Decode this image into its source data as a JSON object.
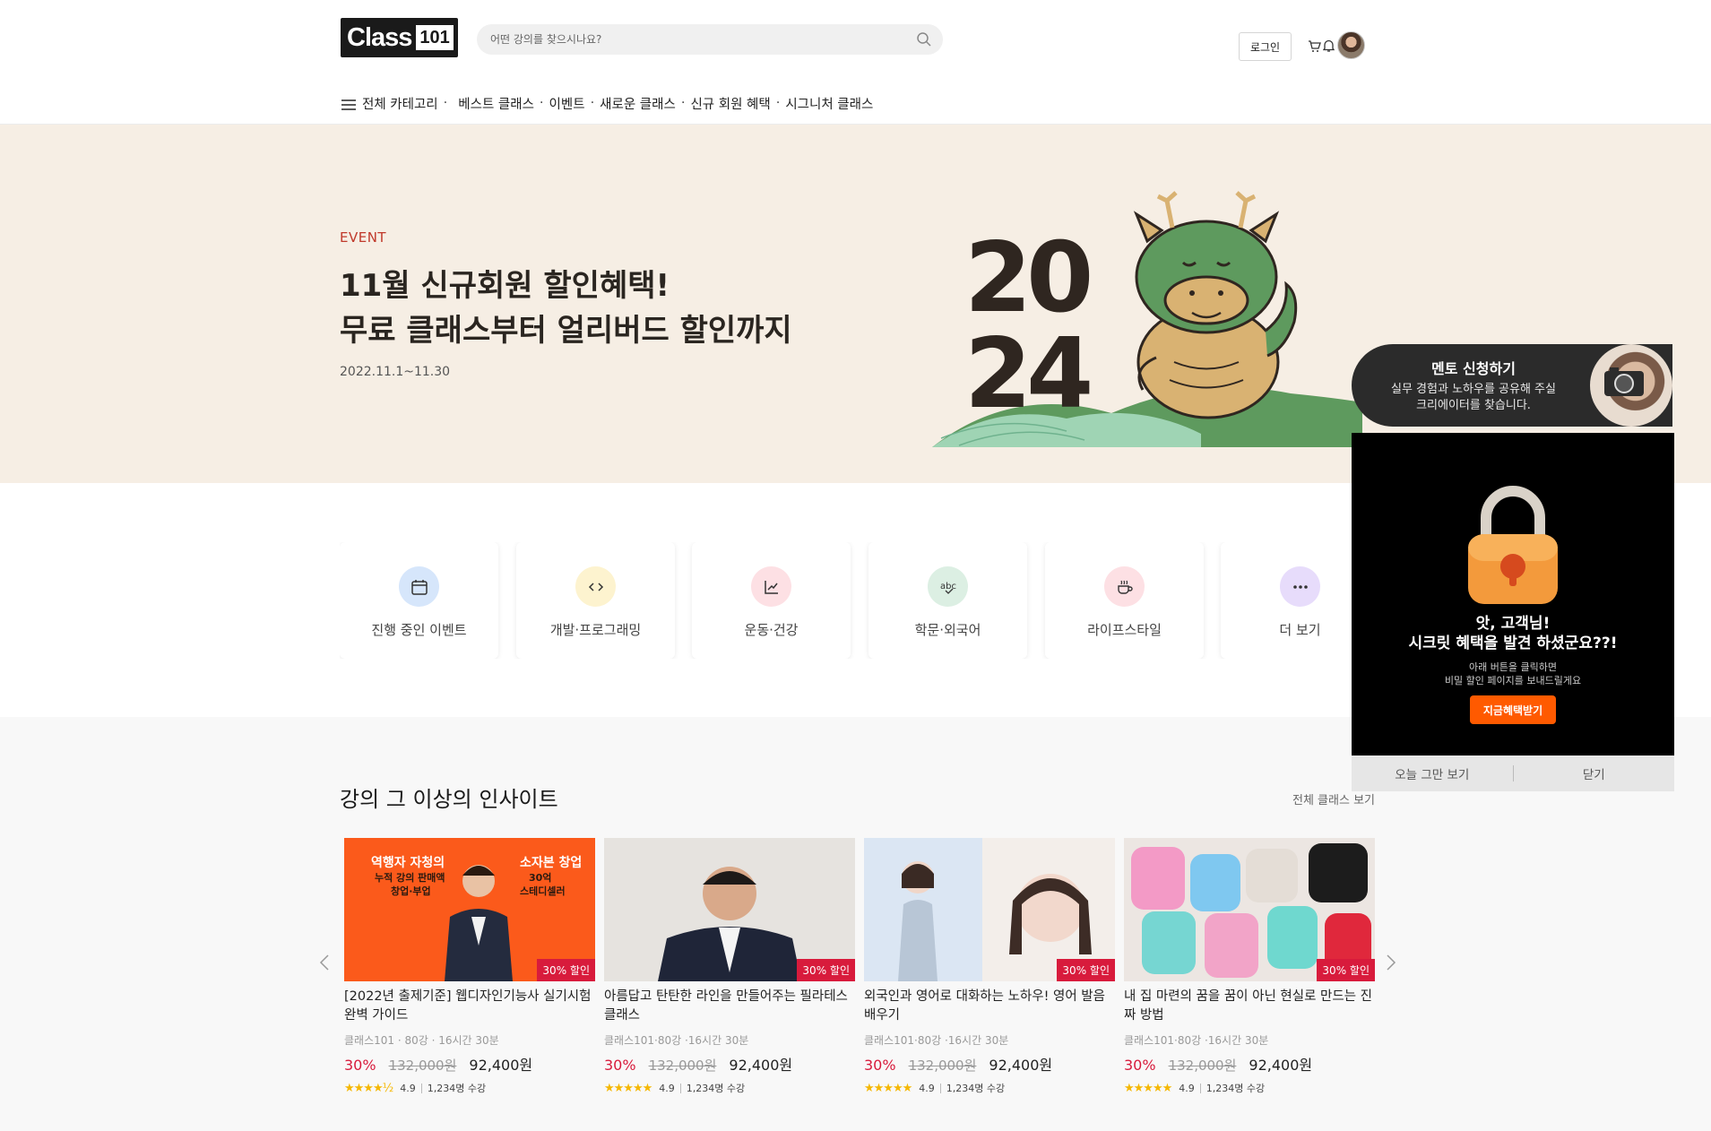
{
  "header": {
    "logo_text": "Class",
    "logo_number": "101",
    "search_placeholder": "어떤 강의를 찾으시나요?",
    "login_label": "로그인"
  },
  "nav": {
    "menu_label": "전체 카테고리",
    "items": [
      "베스트 클래스",
      "이벤트",
      "새로운 클래스",
      "신규 회원 혜택",
      "시그니처 클래스"
    ]
  },
  "hero": {
    "tag": "EVENT",
    "title_line1": "11월 신규회원 할인혜택!",
    "title_line2": "무료 클래스부터 얼리버드 할인까지",
    "date": "2022.11.1~11.30",
    "art_year_top": "20",
    "art_year_bottom": "24"
  },
  "categories": [
    {
      "label": "진행 중인 이벤트",
      "icon": "calendar-icon",
      "color": "#d6e6fb"
    },
    {
      "label": "개발·프로그래밍",
      "icon": "code-icon",
      "color": "#fdf3cf"
    },
    {
      "label": "운동·건강",
      "icon": "chart-icon",
      "color": "#fde0e4"
    },
    {
      "label": "학문·외국어",
      "icon": "abc-icon",
      "color": "#dcefe3"
    },
    {
      "label": "라이프스타일",
      "icon": "coffee-icon",
      "color": "#fde0e4"
    },
    {
      "label": "더 보기",
      "icon": "more-icon",
      "color": "#e7dcfb"
    }
  ],
  "insights": {
    "title": "강의 그 이상의 인사이트",
    "view_all": "전체 클래스 보기",
    "cards": [
      {
        "title": "[2022년 출제기준] 웹디자인기능사 실기시험 완벽 가이드",
        "meta": "클래스101 · 80강 · 16시간 30분",
        "badge": "30% 할인",
        "pct": "30%",
        "orig": "132,000원",
        "final": "92,400원",
        "rating": "4.9",
        "students": "1,234명 수강",
        "thumb_text1": "역행자 자청의",
        "thumb_text2": "누적 강의 판매액",
        "thumb_text3": "창업·부업",
        "thumb_text4": "소자본 창업",
        "thumb_text5": "30억",
        "thumb_text6": "스테디셀러",
        "stars": "★★★★½"
      },
      {
        "title": "아름답고 탄탄한 라인을 만들어주는 필라테스 클래스",
        "meta": "클래스101·80강 ·16시간 30분",
        "badge": "30% 할인",
        "pct": "30%",
        "orig": "132,000원",
        "final": "92,400원",
        "rating": "4.9",
        "students": "1,234명 수강",
        "stars": "★★★★★"
      },
      {
        "title": "외국인과 영어로 대화하는 노하우! 영어 발음 배우기",
        "meta": "클래스101·80강 ·16시간 30분",
        "badge": "30% 할인",
        "pct": "30%",
        "orig": "132,000원",
        "final": "92,400원",
        "rating": "4.9",
        "students": "1,234명 수강",
        "stars": "★★★★★"
      },
      {
        "title": "내 집 마련의 꿈을 꿈이 아닌 현실로 만드는 진짜 방법",
        "meta": "클래스101·80강 ·16시간 30분",
        "badge": "30% 할인",
        "pct": "30%",
        "orig": "132,000원",
        "final": "92,400원",
        "rating": "4.9",
        "students": "1,234명 수강",
        "stars": "★★★★★"
      }
    ]
  },
  "mentor_popup": {
    "title": "멘토 신청하기",
    "desc_line1": "실무 경험과 노하우를 공유해 주실",
    "desc_line2": "크리에이터를 찾습니다."
  },
  "secret_popup": {
    "title_line1": "앗, 고객님!",
    "title_line2": "시크릿 혜택을 발견 하셨군요??!",
    "desc_line1": "아래 버튼을 클릭하면",
    "desc_line2": "비밀 할인 페이지를 보내드릴게요",
    "cta": "지금혜택받기",
    "dismiss_today": "오늘 그만 보기",
    "close": "닫기"
  },
  "colors": {
    "accent_red": "#d81b3c",
    "hero_bg": "#f6eee4",
    "cta_orange": "#ff5a00"
  }
}
